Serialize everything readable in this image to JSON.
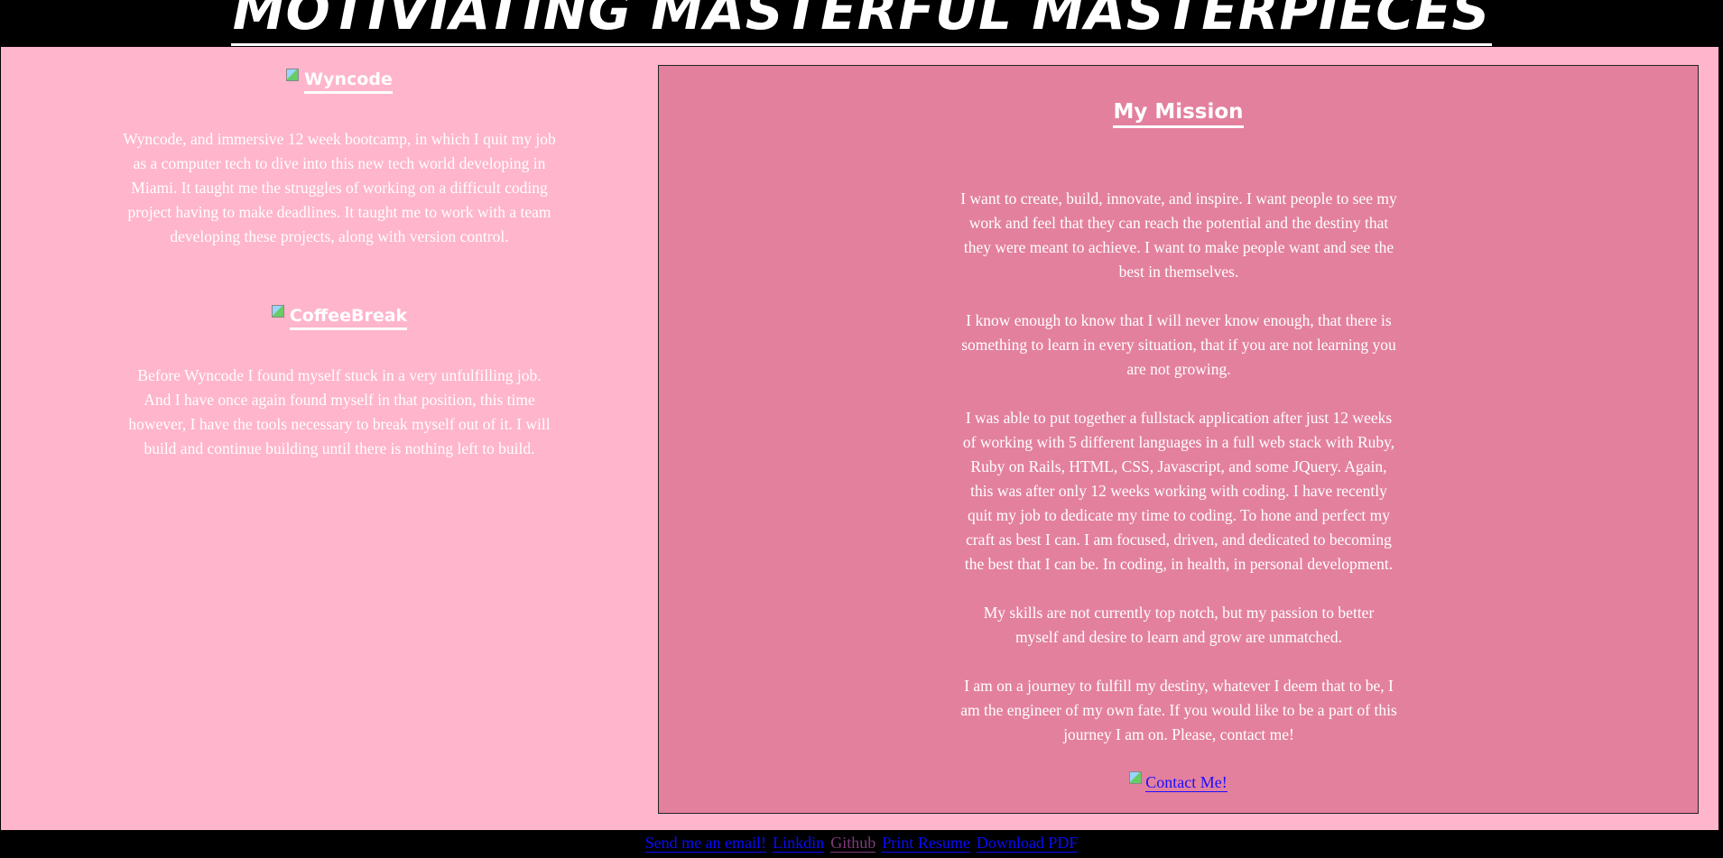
{
  "header": {
    "title": "MOTIVIATING MASTERFUL MASTERPIECES"
  },
  "projects": [
    {
      "name": "Wyncode",
      "icon": "broken-image-icon",
      "description": "Wyncode, and immersive 12 week bootcamp, in which I quit my job as a computer tech to dive into this new tech world developing in Miami. It taught me the struggles of working on a difficult coding project having to make deadlines. It taught me to work with a team developing these projects, along with version control."
    },
    {
      "name": "CoffeeBreak",
      "icon": "broken-image-icon",
      "description": "Before Wyncode I found myself stuck in a very unfulfilling job. And I have once again found myself in that position, this time however, I have the tools necessary to break myself out of it. I will build and continue building until there is nothing left to build."
    }
  ],
  "mission": {
    "title": "My Mission",
    "paragraphs": [
      "I want to create, build, innovate, and inspire. I want people to see my work and feel that they can reach the potential and the destiny that they were meant to achieve. I want to make people want and see the best in themselves.",
      "I know enough to know that I will never know enough, that there is something to learn in every situation, that if you are not learning you are not growing.",
      "I was able to put together a fullstack application after just 12 weeks of working with 5 different languages in a full web stack with Ruby, Ruby on Rails, HTML, CSS, Javascript, and some JQuery. Again, this was after only 12 weeks working with coding. I have recently quit my job to dedicate my time to coding. To hone and perfect my craft as best I can. I am focused, driven, and dedicated to becoming the best that I can be. In coding, in health, in personal development.",
      "My skills are not currently top notch, but my passion to better myself and desire to learn and grow are unmatched.",
      "I am on a journey to fulfill my destiny, whatever I deem that to be, I am the engineer of my own fate. If you would like to be a part of this journey I am on. Please, contact me!"
    ],
    "contact_label": "Contact Me!"
  },
  "footer": {
    "links": [
      {
        "label": "Send me an email!",
        "color": "#0a0aff"
      },
      {
        "label": "Linkdin",
        "color": "#0a0aff"
      },
      {
        "label": "Github",
        "color": "#7f3b7a"
      },
      {
        "label": "Print Resume",
        "color": "#0a0aff"
      },
      {
        "label": "Download PDF",
        "color": "#0a0aff"
      }
    ]
  },
  "colors": {
    "page_background": "#ffb5cc",
    "mission_background": "#e3809e",
    "header_background": "#000000"
  }
}
